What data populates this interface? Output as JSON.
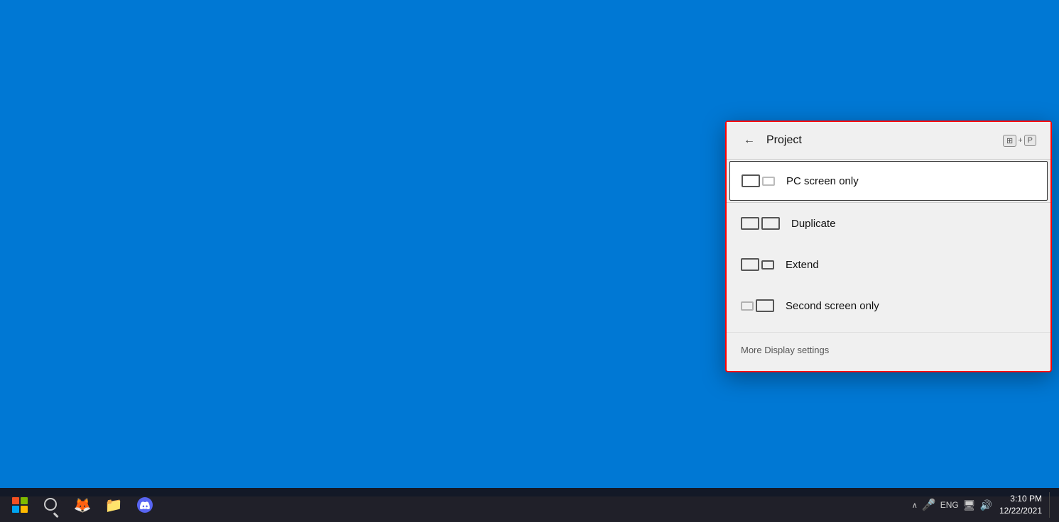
{
  "desktop": {
    "background_color": "#0078d4"
  },
  "panel": {
    "title": "Project",
    "shortcut_win": "⊞",
    "shortcut_plus": "+",
    "shortcut_p": "P",
    "back_label": "←",
    "options": [
      {
        "id": "pc-screen-only",
        "label": "PC screen only",
        "active": true,
        "icon_type": "pc-only"
      },
      {
        "id": "duplicate",
        "label": "Duplicate",
        "active": false,
        "icon_type": "duplicate"
      },
      {
        "id": "extend",
        "label": "Extend",
        "active": false,
        "icon_type": "extend"
      },
      {
        "id": "second-screen-only",
        "label": "Second screen only",
        "active": false,
        "icon_type": "second-only"
      }
    ],
    "more_settings_label": "More Display settings"
  },
  "taskbar": {
    "clock": {
      "time": "3:10 PM",
      "date": "12/22/2021"
    },
    "tray": {
      "language": "ENG"
    }
  }
}
